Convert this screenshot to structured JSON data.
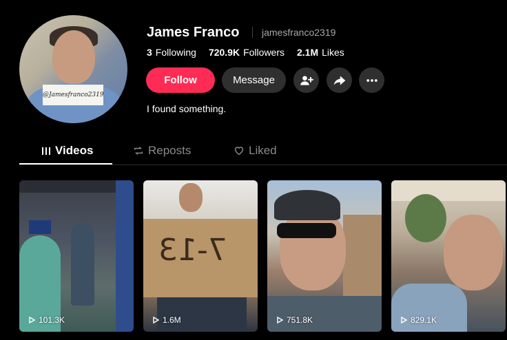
{
  "profile": {
    "display_name": "James Franco",
    "username": "jamesfranco2319",
    "avatar_sign_text": "@Jamesfranco2319",
    "stats": [
      {
        "value": "3",
        "label": "Following"
      },
      {
        "value": "720.9K",
        "label": "Followers"
      },
      {
        "value": "2.1M",
        "label": "Likes"
      }
    ],
    "bio": "I found something."
  },
  "actions": {
    "follow_label": "Follow",
    "message_label": "Message",
    "icons": [
      "add-friend-icon",
      "share-icon",
      "more-icon"
    ]
  },
  "tabs": [
    {
      "label": "Videos",
      "icon": "grid-bars-icon",
      "active": true
    },
    {
      "label": "Reposts",
      "icon": "repost-icon",
      "active": false
    },
    {
      "label": "Liked",
      "icon": "heart-outline-icon",
      "active": false
    }
  ],
  "videos": [
    {
      "views": "101.3K"
    },
    {
      "views": "1.6M"
    },
    {
      "views": "751.8K"
    },
    {
      "views": "829.1K"
    }
  ],
  "colors": {
    "background": "#000000",
    "follow_button": "#fe2c55",
    "secondary_button": "#2f2f2f",
    "muted_text": "#a8a8a8"
  }
}
